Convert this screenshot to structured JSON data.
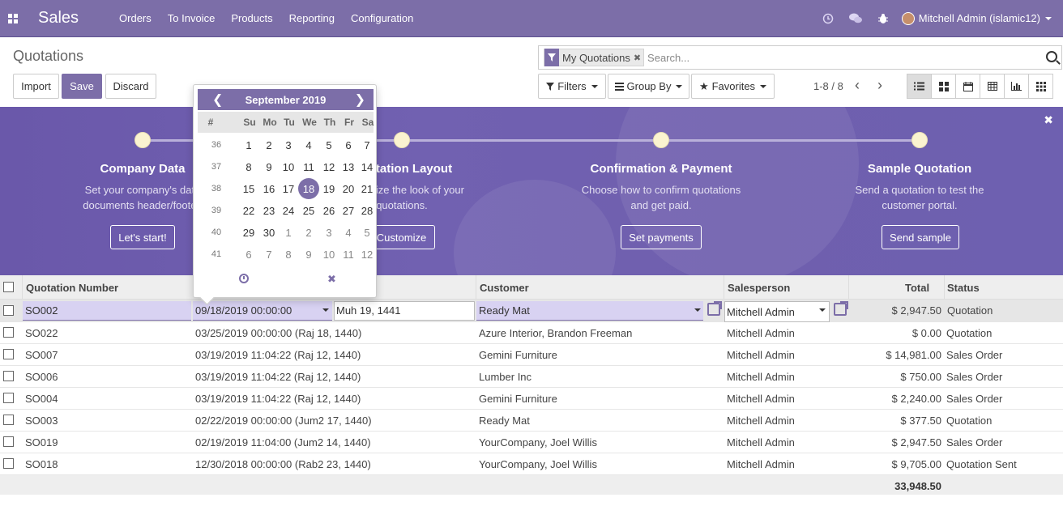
{
  "navbar": {
    "brand": "Sales",
    "menu": [
      "Orders",
      "To Invoice",
      "Products",
      "Reporting",
      "Configuration"
    ],
    "user": "Mitchell Admin (islamic12)"
  },
  "control": {
    "title": "Quotations",
    "import_label": "Import",
    "save_label": "Save",
    "discard_label": "Discard",
    "facet": "My Quotations",
    "search_placeholder": "Search...",
    "filters_label": "Filters",
    "groupby_label": "Group By",
    "favorites_label": "Favorites",
    "pager": "1-8 / 8"
  },
  "banner": {
    "steps": [
      {
        "title": "Company Data",
        "desc1": "Set your company's data",
        "desc2": "documents header/footer.",
        "button": "Let's start!"
      },
      {
        "title": "Quotation Layout",
        "desc1": "Customize the look of your",
        "desc2": "quotations.",
        "button": "Customize"
      },
      {
        "title": "Confirmation & Payment",
        "desc1": "Choose how to confirm quotations",
        "desc2": "and get paid.",
        "button": "Set payments"
      },
      {
        "title": "Sample Quotation",
        "desc1": "Send a quotation to test the",
        "desc2": "customer portal.",
        "button": "Send sample"
      }
    ]
  },
  "table": {
    "headers": {
      "number": "Quotation Number",
      "customer": "Customer",
      "salesperson": "Salesperson",
      "total": "Total",
      "status": "Status"
    },
    "edit_row": {
      "number": "SO002",
      "date": "09/18/2019 00:00:00",
      "hijri": "Muh 19, 1441",
      "customer": "Ready Mat",
      "salesperson": "Mitchell Admin",
      "total": "$ 2,947.50",
      "status": "Quotation"
    },
    "rows": [
      {
        "number": "SO022",
        "date": "03/25/2019 00:00:00 (Raj 18, 1440)",
        "customer": "Azure Interior, Brandon Freeman",
        "salesperson": "Mitchell Admin",
        "total": "$ 0.00",
        "status": "Quotation"
      },
      {
        "number": "SO007",
        "date": "03/19/2019 11:04:22 (Raj 12, 1440)",
        "customer": "Gemini Furniture",
        "salesperson": "Mitchell Admin",
        "total": "$ 14,981.00",
        "status": "Sales Order"
      },
      {
        "number": "SO006",
        "date": "03/19/2019 11:04:22 (Raj 12, 1440)",
        "customer": "Lumber Inc",
        "salesperson": "Mitchell Admin",
        "total": "$ 750.00",
        "status": "Sales Order"
      },
      {
        "number": "SO004",
        "date": "03/19/2019 11:04:22 (Raj 12, 1440)",
        "customer": "Gemini Furniture",
        "salesperson": "Mitchell Admin",
        "total": "$ 2,240.00",
        "status": "Sales Order"
      },
      {
        "number": "SO003",
        "date": "02/22/2019 00:00:00 (Jum2 17, 1440)",
        "customer": "Ready Mat",
        "salesperson": "Mitchell Admin",
        "total": "$ 377.50",
        "status": "Quotation"
      },
      {
        "number": "SO019",
        "date": "02/19/2019 11:04:00 (Jum2 14, 1440)",
        "customer": "YourCompany, Joel Willis",
        "salesperson": "Mitchell Admin",
        "total": "$ 2,947.50",
        "status": "Sales Order"
      },
      {
        "number": "SO018",
        "date": "12/30/2018 00:00:00 (Rab2 23, 1440)",
        "customer": "YourCompany, Joel Willis",
        "salesperson": "Mitchell Admin",
        "total": "$ 9,705.00",
        "status": "Quotation Sent"
      }
    ],
    "grand_total": "33,948.50"
  },
  "datepicker": {
    "month_label": "September 2019",
    "dow": [
      "#",
      "Su",
      "Mo",
      "Tu",
      "We",
      "Th",
      "Fr",
      "Sa"
    ],
    "weeks": [
      {
        "wk": "36",
        "days": [
          "1",
          "2",
          "3",
          "4",
          "5",
          "6",
          "7"
        ]
      },
      {
        "wk": "37",
        "days": [
          "8",
          "9",
          "10",
          "11",
          "12",
          "13",
          "14"
        ]
      },
      {
        "wk": "38",
        "days": [
          "15",
          "16",
          "17",
          "18",
          "19",
          "20",
          "21"
        ]
      },
      {
        "wk": "39",
        "days": [
          "22",
          "23",
          "24",
          "25",
          "26",
          "27",
          "28"
        ]
      },
      {
        "wk": "40",
        "days": [
          "29",
          "30",
          "1",
          "2",
          "3",
          "4",
          "5"
        ]
      },
      {
        "wk": "41",
        "days": [
          "6",
          "7",
          "8",
          "9",
          "10",
          "11",
          "12"
        ]
      }
    ],
    "selected_day": "18",
    "colors": {
      "accent": "#7c6ea8"
    }
  }
}
